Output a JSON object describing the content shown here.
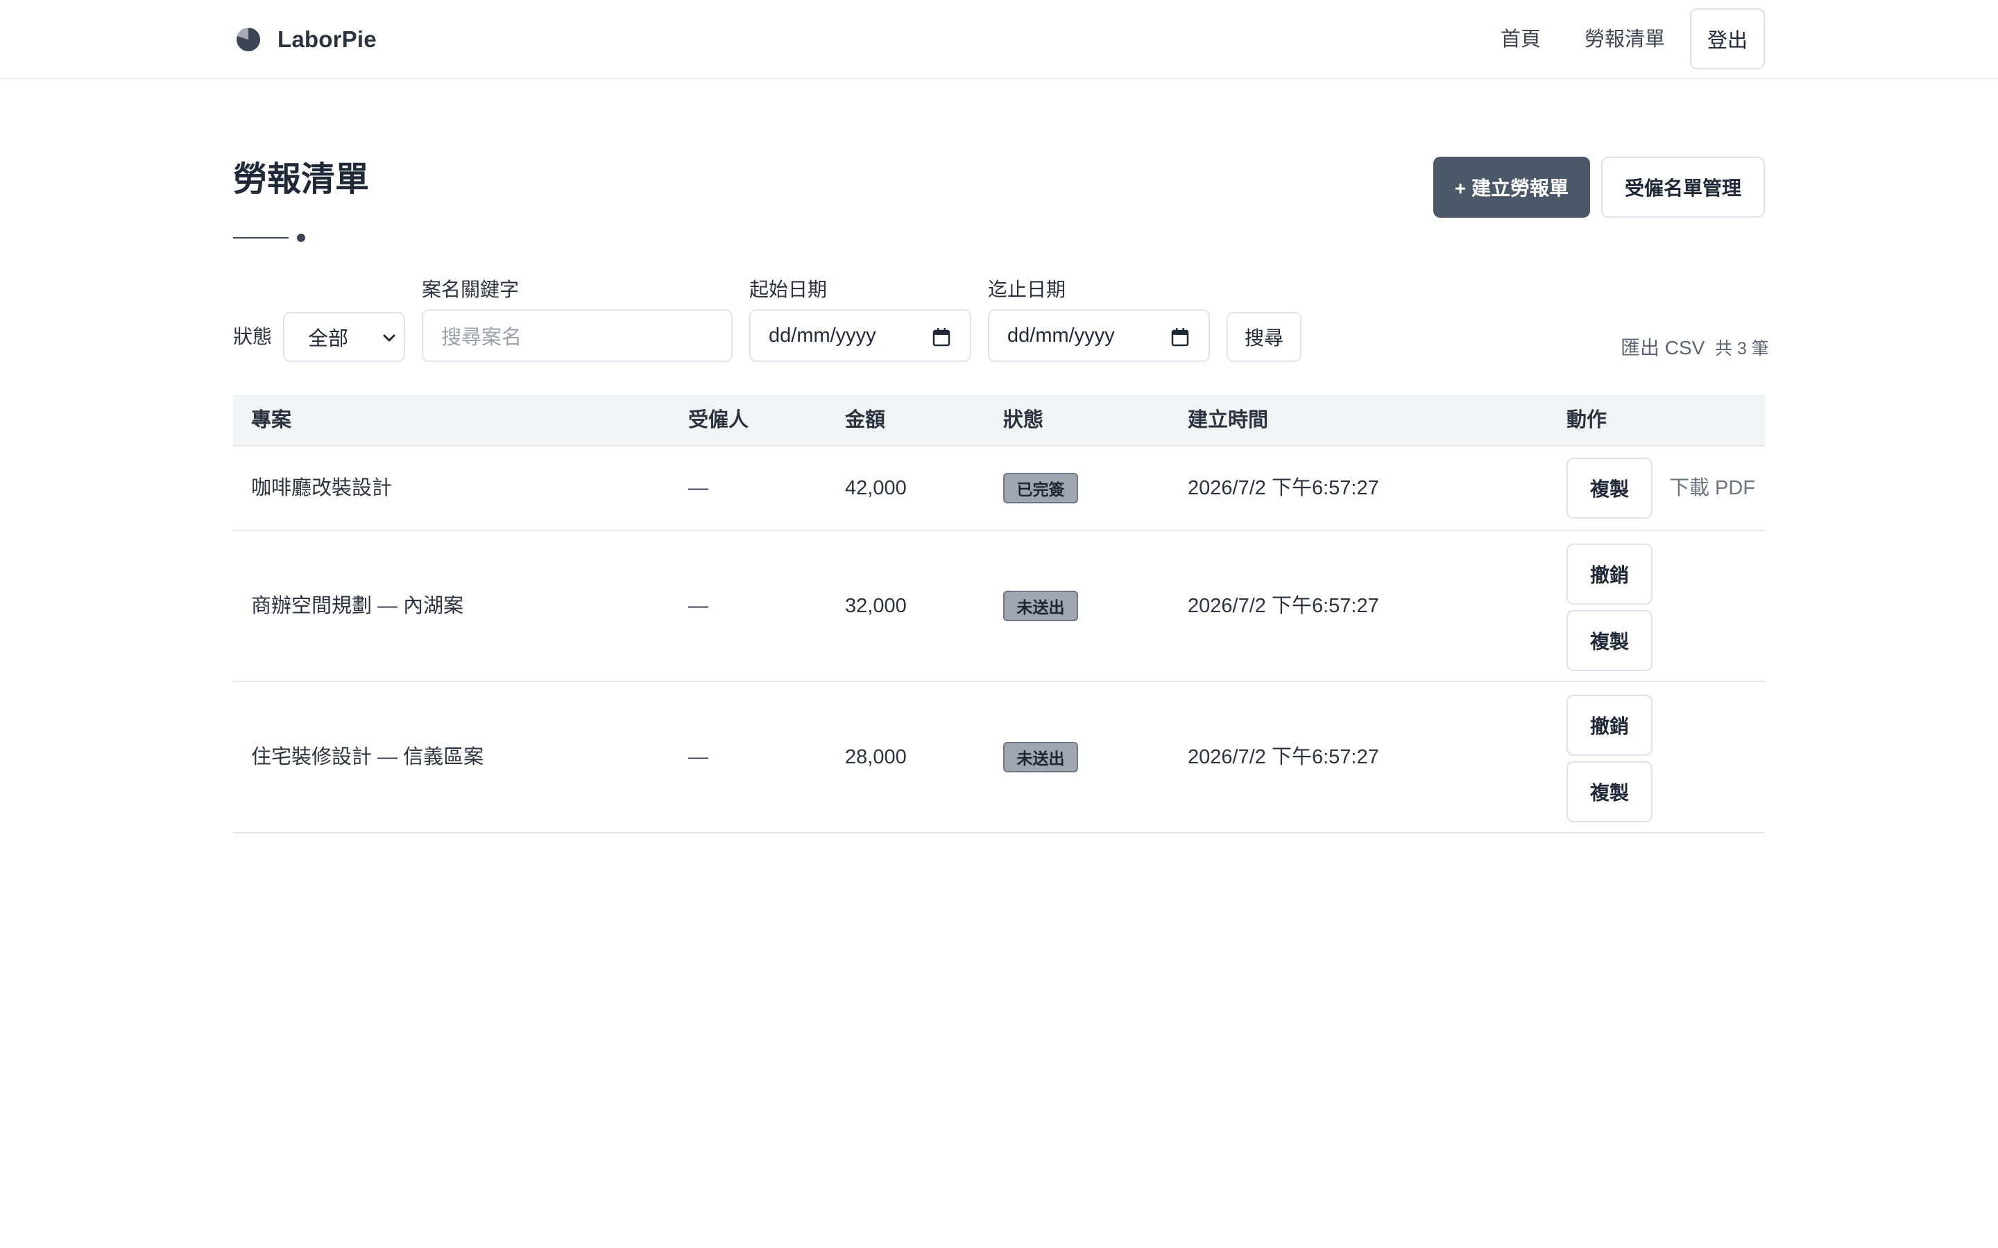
{
  "app": {
    "brand": "LaborPie",
    "icon": "pie-chart-icon"
  },
  "nav": {
    "home": "首頁",
    "list": "勞報清單",
    "logout": "登出"
  },
  "page": {
    "title": "勞報清單",
    "create_button": "+ 建立勞報單",
    "roster_button": "受僱名單管理"
  },
  "filters": {
    "status_label": "狀態",
    "status_value": "全部",
    "keyword_label": "案名關鍵字",
    "keyword_placeholder": "搜尋案名",
    "start_label": "起始日期",
    "start_value": "dd/mm/yyyy",
    "end_label": "迄止日期",
    "end_value": "dd/mm/yyyy",
    "search_button": "搜尋",
    "export_csv": "匯出 CSV",
    "total": "共 3 筆"
  },
  "table": {
    "headers": [
      "專案",
      "受僱人",
      "金額",
      "狀態",
      "建立時間",
      "動作"
    ],
    "rows": [
      {
        "project": "咖啡廳改裝設計",
        "employee": "—",
        "amount": "42,000",
        "status": "已完簽",
        "created": "2026/7/2 下午6:57:27",
        "copy": "複製",
        "pdf": "下載 PDF"
      },
      {
        "project": "商辦空間規劃 — 內湖案",
        "employee": "—",
        "amount": "32,000",
        "status": "未送出",
        "created": "2026/7/2 下午6:57:27",
        "revoke": "撤銷",
        "copy": "複製"
      },
      {
        "project": "住宅裝修設計 — 信義區案",
        "employee": "—",
        "amount": "28,000",
        "status": "未送出",
        "created": "2026/7/2 下午6:57:27",
        "revoke": "撤銷",
        "copy": "複製"
      }
    ]
  },
  "colors": {
    "primary_button": "#4b5868",
    "badge_bg": "#9ea7b1",
    "header_bg": "#f1f4f7"
  }
}
